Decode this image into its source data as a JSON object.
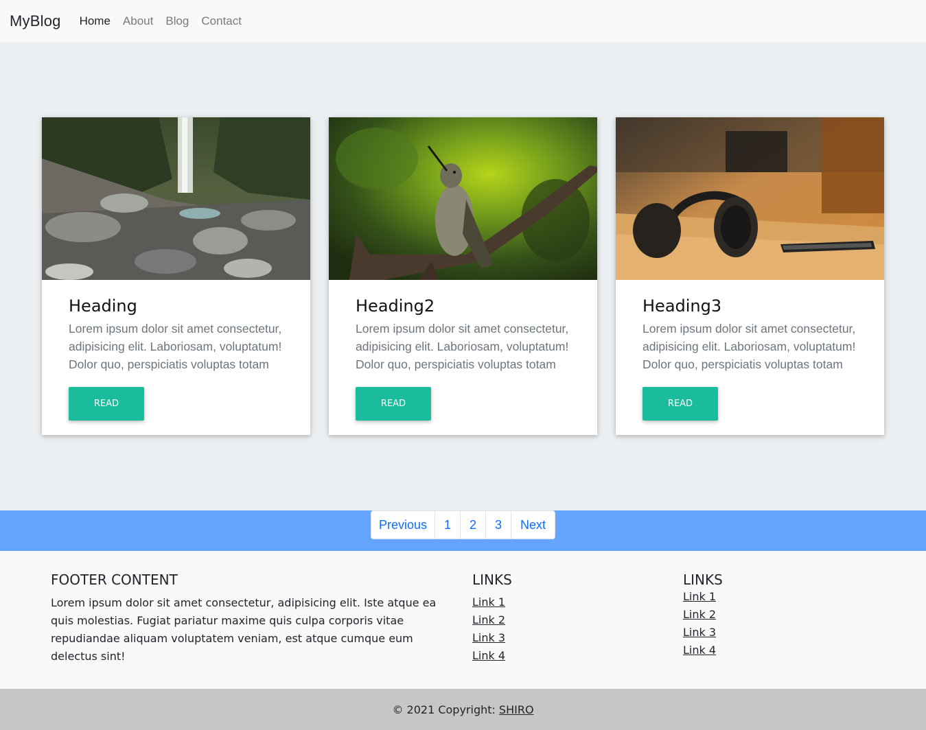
{
  "navbar": {
    "brand": "MyBlog",
    "links": [
      "Home",
      "About",
      "Blog",
      "Contact"
    ],
    "active": "Home"
  },
  "cards": [
    {
      "image": "waterfall-photo",
      "title": "Heading",
      "text": "Lorem ipsum dolor sit amet consectetur, adipisicing elit. Laboriosam, voluptatum! Dolor quo, perspiciatis voluptas totam",
      "button": "READ"
    },
    {
      "image": "hummingbird-photo",
      "title": "Heading2",
      "text": "Lorem ipsum dolor sit amet consectetur, adipisicing elit. Laboriosam, voluptatum! Dolor quo, perspiciatis voluptas totam",
      "button": "READ"
    },
    {
      "image": "headphones-photo",
      "title": "Heading3",
      "text": "Lorem ipsum dolor sit amet consectetur, adipisicing elit. Laboriosam, voluptatum! Dolor quo, perspiciatis voluptas totam",
      "button": "READ"
    }
  ],
  "pagination": {
    "previous": "Previous",
    "pages": [
      "1",
      "2",
      "3"
    ],
    "next": "Next"
  },
  "footer": {
    "heading": "FOOTER CONTENT",
    "text": "Lorem ipsum dolor sit amet consectetur, adipisicing elit. Iste atque ea quis molestias. Fugiat pariatur maxime quis culpa corporis vitae repudiandae aliquam voluptatem veniam, est atque cumque eum delectus sint!",
    "links_col1": {
      "heading": "LINKS",
      "items": [
        "Link 1",
        "Link 2",
        "Link 3",
        "Link 4"
      ]
    },
    "links_col2": {
      "heading": "LINKS",
      "items": [
        "Link 1",
        "Link 2",
        "Link 3",
        "Link 4"
      ]
    }
  },
  "copyright": {
    "text": "© 2021 Copyright:",
    "link": "SHIRO"
  },
  "colors": {
    "accent": "#1abc9c",
    "pager_band": "#64a6ff",
    "page_background": "#eceff1",
    "copyright_background": "#c6c6c6"
  }
}
